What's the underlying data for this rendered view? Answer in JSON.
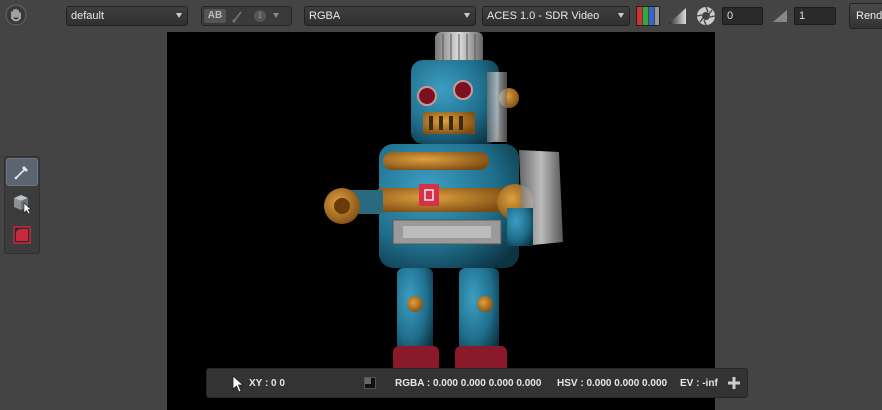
{
  "toolbar": {
    "view_select": "default",
    "ab_label": "AB",
    "layer_count": "1",
    "channel_select": "RGBA",
    "colorspace_select": "ACES 1.0 - SDR Video",
    "exposure_value": "0",
    "gamma_value": "1",
    "render_label": "Rende"
  },
  "status": {
    "xy": "XY : 0 0",
    "rgba": "RGBA : 0.000 0.000 0.000 0.000",
    "hsv": "HSV : 0.000 0.000 0.000",
    "ev": "EV : -inf"
  },
  "colors": {
    "background": "#444444",
    "viewport": "#000000",
    "robot_blue": "#1f6f8c",
    "accent_red": "#c8283c",
    "tool_active": "#5a6570"
  },
  "icons": [
    "hand-icon",
    "ab-compare-icon",
    "brush-icon",
    "rgb-channels-icon",
    "gamma-ramp-icon",
    "exposure-aperture-icon",
    "gamma-triangle-icon",
    "eyedropper-icon",
    "cube-select-icon",
    "crop-region-icon",
    "cursor-icon",
    "swatch-icon",
    "plus-icon"
  ]
}
